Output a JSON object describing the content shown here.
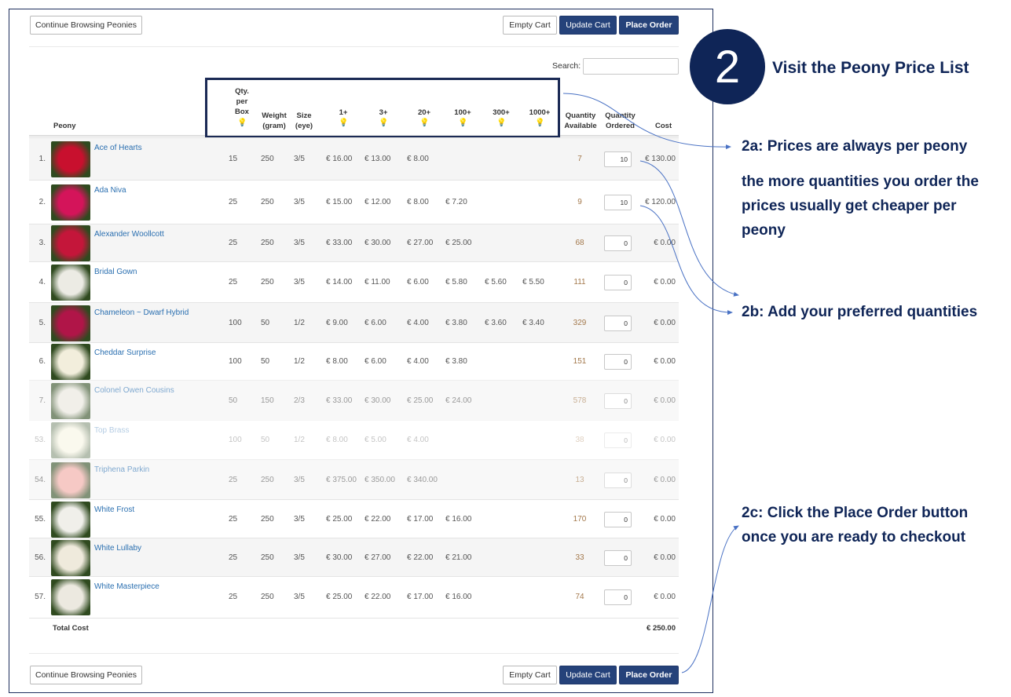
{
  "toolbar": {
    "continue_label": "Continue Browsing Peonies",
    "empty_label": "Empty Cart",
    "update_label": "Update Cart",
    "place_label": "Place Order"
  },
  "search": {
    "label": "Search:",
    "value": ""
  },
  "table": {
    "headers": {
      "peony": "Peony",
      "qty_per_box": "Qty. per Box",
      "weight": "Weight (gram)",
      "size": "Size (eye)",
      "p1": "1+",
      "p3": "3+",
      "p20": "20+",
      "p100": "100+",
      "p300": "300+",
      "p1000": "1000+",
      "available": "Quantity Available",
      "ordered": "Quantity Ordered",
      "cost": "Cost"
    },
    "rows": [
      {
        "idx": "1.",
        "name": "Ace of Hearts",
        "qty": "15",
        "weight": "250",
        "size": "3/5",
        "p1": "€ 16.00",
        "p3": "€ 13.00",
        "p20": "€ 8.00",
        "p100": "",
        "p300": "",
        "p1000": "",
        "avail": "7",
        "ordered": "10",
        "cost": "€ 130.00",
        "color": "#c8102e"
      },
      {
        "idx": "2.",
        "name": "Ada Niva",
        "qty": "25",
        "weight": "250",
        "size": "3/5",
        "p1": "€ 15.00",
        "p3": "€ 12.00",
        "p20": "€ 8.00",
        "p100": "€ 7.20",
        "p300": "",
        "p1000": "",
        "avail": "9",
        "ordered": "10",
        "cost": "€ 120.00",
        "color": "#d4145a"
      },
      {
        "idx": "3.",
        "name": "Alexander Woollcott",
        "qty": "25",
        "weight": "250",
        "size": "3/5",
        "p1": "€ 33.00",
        "p3": "€ 30.00",
        "p20": "€ 27.00",
        "p100": "€ 25.00",
        "p300": "",
        "p1000": "",
        "avail": "68",
        "ordered": "0",
        "cost": "€ 0.00",
        "color": "#c4163a"
      },
      {
        "idx": "4.",
        "name": "Bridal Gown",
        "qty": "25",
        "weight": "250",
        "size": "3/5",
        "p1": "€ 14.00",
        "p3": "€ 11.00",
        "p20": "€ 6.00",
        "p100": "€ 5.80",
        "p300": "€ 5.60",
        "p1000": "€ 5.50",
        "avail": "111",
        "ordered": "0",
        "cost": "€ 0.00",
        "color": "#ecebe4"
      },
      {
        "idx": "5.",
        "name": "Chameleon ~ Dwarf Hybrid",
        "qty": "100",
        "weight": "50",
        "size": "1/2",
        "p1": "€ 9.00",
        "p3": "€ 6.00",
        "p20": "€ 4.00",
        "p100": "€ 3.80",
        "p300": "€ 3.60",
        "p1000": "€ 3.40",
        "avail": "329",
        "ordered": "0",
        "cost": "€ 0.00",
        "color": "#b01548"
      },
      {
        "idx": "6.",
        "name": "Cheddar Surprise",
        "qty": "100",
        "weight": "50",
        "size": "1/2",
        "p1": "€ 8.00",
        "p3": "€ 6.00",
        "p20": "€ 4.00",
        "p100": "€ 3.80",
        "p300": "",
        "p1000": "",
        "avail": "151",
        "ordered": "0",
        "cost": "€ 0.00",
        "color": "#f2eedc"
      },
      {
        "idx": "7.",
        "name": "Colonel Owen Cousins",
        "qty": "50",
        "weight": "150",
        "size": "2/3",
        "p1": "€ 33.00",
        "p3": "€ 30.00",
        "p20": "€ 25.00",
        "p100": "€ 24.00",
        "p300": "",
        "p1000": "",
        "avail": "578",
        "ordered": "0",
        "cost": "€ 0.00",
        "color": "#e9e6dc"
      },
      {
        "idx": "53.",
        "name": "Top Brass",
        "qty": "100",
        "weight": "50",
        "size": "1/2",
        "p1": "€ 8.00",
        "p3": "€ 5.00",
        "p20": "€ 4.00",
        "p100": "",
        "p300": "",
        "p1000": "",
        "avail": "38",
        "ordered": "0",
        "cost": "€ 0.00",
        "color": "#f3efd0"
      },
      {
        "idx": "54.",
        "name": "Triphena Parkin",
        "qty": "25",
        "weight": "250",
        "size": "3/5",
        "p1": "€ 375.00",
        "p3": "€ 350.00",
        "p20": "€ 340.00",
        "p100": "",
        "p300": "",
        "p1000": "",
        "avail": "13",
        "ordered": "0",
        "cost": "€ 0.00",
        "color": "#f1a6a0"
      },
      {
        "idx": "55.",
        "name": "White Frost",
        "qty": "25",
        "weight": "250",
        "size": "3/5",
        "p1": "€ 25.00",
        "p3": "€ 22.00",
        "p20": "€ 17.00",
        "p100": "€ 16.00",
        "p300": "",
        "p1000": "",
        "avail": "170",
        "ordered": "0",
        "cost": "€ 0.00",
        "color": "#f0efea"
      },
      {
        "idx": "56.",
        "name": "White Lullaby",
        "qty": "25",
        "weight": "250",
        "size": "3/5",
        "p1": "€ 30.00",
        "p3": "€ 27.00",
        "p20": "€ 22.00",
        "p100": "€ 21.00",
        "p300": "",
        "p1000": "",
        "avail": "33",
        "ordered": "0",
        "cost": "€ 0.00",
        "color": "#efeadc"
      },
      {
        "idx": "57.",
        "name": "White Masterpiece",
        "qty": "25",
        "weight": "250",
        "size": "3/5",
        "p1": "€ 25.00",
        "p3": "€ 22.00",
        "p20": "€ 17.00",
        "p100": "€ 16.00",
        "p300": "",
        "p1000": "",
        "avail": "74",
        "ordered": "0",
        "cost": "€ 0.00",
        "color": "#ece9e0"
      }
    ],
    "total_label": "Total Cost",
    "total_value": "€ 250.00"
  },
  "annotations": {
    "step_number": "2",
    "title": "Visit the Peony Price List",
    "a2": "2a: Prices are always per peony",
    "a2_detail_1": "the more quantities you order the",
    "a2_detail_2": "prices usually get cheaper per",
    "a2_detail_3": "peony",
    "b2": "2b: Add your preferred quantities",
    "c2_1": "2c: Click the Place Order button",
    "c2_2": "once you are ready to checkout"
  },
  "colors": {
    "primary_button": "#25427a",
    "annotation": "#0f2557",
    "link": "#2a6fb0"
  }
}
